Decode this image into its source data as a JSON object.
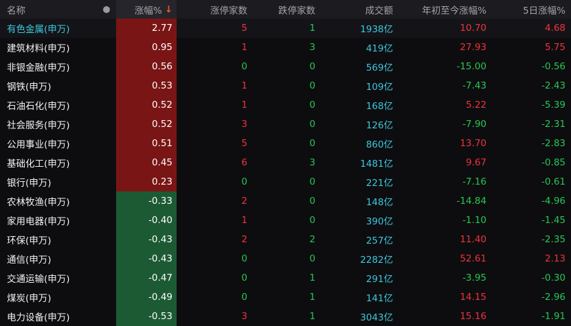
{
  "columns": {
    "name": "名称",
    "pct": "涨幅%",
    "pct_sort": "↓",
    "limit_up": "涨停家数",
    "limit_down": "跌停家数",
    "volume": "成交额",
    "ytd": "年初至今涨幅%",
    "d5": "5日涨幅%"
  },
  "colors": {
    "up": "#f0323c",
    "down": "#28c850",
    "volume": "#3cc8dc",
    "pct_up_bg": "#7a1515",
    "pct_down_bg": "#1c5a34"
  },
  "rows": [
    {
      "name": "有色金属(申万)",
      "pct": "2.77",
      "limit_up": "5",
      "limit_down": "1",
      "volume": "1938亿",
      "ytd": "10.70",
      "d5": "4.68"
    },
    {
      "name": "建筑材料(申万)",
      "pct": "0.95",
      "limit_up": "1",
      "limit_down": "3",
      "volume": "419亿",
      "ytd": "27.93",
      "d5": "5.75"
    },
    {
      "name": "非银金融(申万)",
      "pct": "0.56",
      "limit_up": "0",
      "limit_down": "0",
      "volume": "569亿",
      "ytd": "-15.00",
      "d5": "-0.56"
    },
    {
      "name": "钢铁(申万)",
      "pct": "0.53",
      "limit_up": "1",
      "limit_down": "0",
      "volume": "109亿",
      "ytd": "-7.43",
      "d5": "-2.43"
    },
    {
      "name": "石油石化(申万)",
      "pct": "0.52",
      "limit_up": "1",
      "limit_down": "0",
      "volume": "168亿",
      "ytd": "5.22",
      "d5": "-5.39"
    },
    {
      "name": "社会服务(申万)",
      "pct": "0.52",
      "limit_up": "3",
      "limit_down": "0",
      "volume": "126亿",
      "ytd": "-7.90",
      "d5": "-2.31"
    },
    {
      "name": "公用事业(申万)",
      "pct": "0.51",
      "limit_up": "5",
      "limit_down": "0",
      "volume": "860亿",
      "ytd": "13.70",
      "d5": "-2.83"
    },
    {
      "name": "基础化工(申万)",
      "pct": "0.45",
      "limit_up": "6",
      "limit_down": "3",
      "volume": "1481亿",
      "ytd": "9.67",
      "d5": "-0.85"
    },
    {
      "name": "银行(申万)",
      "pct": "0.23",
      "limit_up": "0",
      "limit_down": "0",
      "volume": "221亿",
      "ytd": "-7.16",
      "d5": "-0.61"
    },
    {
      "name": "农林牧渔(申万)",
      "pct": "-0.33",
      "limit_up": "2",
      "limit_down": "0",
      "volume": "148亿",
      "ytd": "-14.84",
      "d5": "-4.96"
    },
    {
      "name": "家用电器(申万)",
      "pct": "-0.40",
      "limit_up": "1",
      "limit_down": "0",
      "volume": "390亿",
      "ytd": "-1.10",
      "d5": "-1.45"
    },
    {
      "name": "环保(申万)",
      "pct": "-0.43",
      "limit_up": "2",
      "limit_down": "2",
      "volume": "257亿",
      "ytd": "11.40",
      "d5": "-2.35"
    },
    {
      "name": "通信(申万)",
      "pct": "-0.43",
      "limit_up": "0",
      "limit_down": "0",
      "volume": "2282亿",
      "ytd": "52.61",
      "d5": "2.13"
    },
    {
      "name": "交通运输(申万)",
      "pct": "-0.47",
      "limit_up": "0",
      "limit_down": "1",
      "volume": "291亿",
      "ytd": "-3.95",
      "d5": "-0.30"
    },
    {
      "name": "煤炭(申万)",
      "pct": "-0.49",
      "limit_up": "0",
      "limit_down": "1",
      "volume": "141亿",
      "ytd": "14.15",
      "d5": "-2.96"
    },
    {
      "name": "电力设备(申万)",
      "pct": "-0.53",
      "limit_up": "3",
      "limit_down": "1",
      "volume": "3043亿",
      "ytd": "15.16",
      "d5": "-1.91"
    }
  ]
}
